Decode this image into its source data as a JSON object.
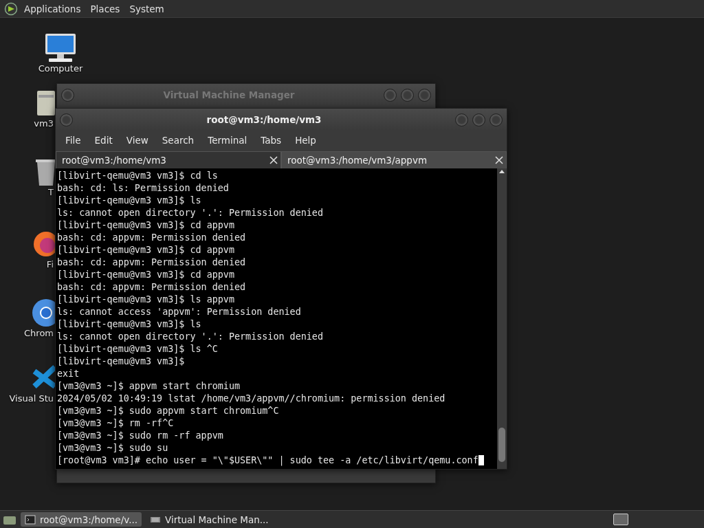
{
  "top_panel": {
    "menus": [
      "Applications",
      "Places",
      "System"
    ]
  },
  "desktop_icons": [
    {
      "kind": "computer",
      "label": "Computer"
    },
    {
      "kind": "folder",
      "label": "vm3"
    },
    {
      "kind": "trash",
      "label": "T"
    },
    {
      "kind": "firefox",
      "label": "Fi"
    },
    {
      "kind": "chromium",
      "label": "Chrom"
    },
    {
      "kind": "vscode",
      "label": "Visual Stu"
    }
  ],
  "back_window": {
    "title": "Virtual Machine Manager",
    "active": false
  },
  "terminal_window": {
    "title": "root@vm3:/home/vm3",
    "active": true,
    "menu": [
      "File",
      "Edit",
      "View",
      "Search",
      "Terminal",
      "Tabs",
      "Help"
    ],
    "tabs": [
      {
        "label": "root@vm3:/home/vm3",
        "selected": true
      },
      {
        "label": "root@vm3:/home/vm3/appvm",
        "selected": false
      }
    ],
    "lines": [
      "[libvirt-qemu@vm3 vm3]$ cd ls",
      "bash: cd: ls: Permission denied",
      "[libvirt-qemu@vm3 vm3]$ ls",
      "ls: cannot open directory '.': Permission denied",
      "[libvirt-qemu@vm3 vm3]$ cd appvm",
      "bash: cd: appvm: Permission denied",
      "[libvirt-qemu@vm3 vm3]$ cd appvm",
      "bash: cd: appvm: Permission denied",
      "[libvirt-qemu@vm3 vm3]$ cd appvm",
      "bash: cd: appvm: Permission denied",
      "[libvirt-qemu@vm3 vm3]$ ls appvm",
      "ls: cannot access 'appvm': Permission denied",
      "[libvirt-qemu@vm3 vm3]$ ls",
      "ls: cannot open directory '.': Permission denied",
      "[libvirt-qemu@vm3 vm3]$ ls ^C",
      "[libvirt-qemu@vm3 vm3]$",
      "exit",
      "[vm3@vm3 ~]$ appvm start chromium",
      "2024/05/02 10:49:19 lstat /home/vm3/appvm//chromium: permission denied",
      "[vm3@vm3 ~]$ sudo appvm start chromium^C",
      "[vm3@vm3 ~]$ rm -rf^C",
      "[vm3@vm3 ~]$ sudo rm -rf appvm",
      "[vm3@vm3 ~]$ sudo su",
      "[root@vm3 vm3]# echo user = \"\\\"$USER\\\"\" | sudo tee -a /etc/libvirt/qemu.conf"
    ],
    "cursor_visible": true
  },
  "taskbar": {
    "items": [
      {
        "label": "root@vm3:/home/v...",
        "selected": true,
        "kind": "terminal"
      },
      {
        "label": "Virtual Machine Man...",
        "selected": false,
        "kind": "vmm"
      }
    ]
  }
}
